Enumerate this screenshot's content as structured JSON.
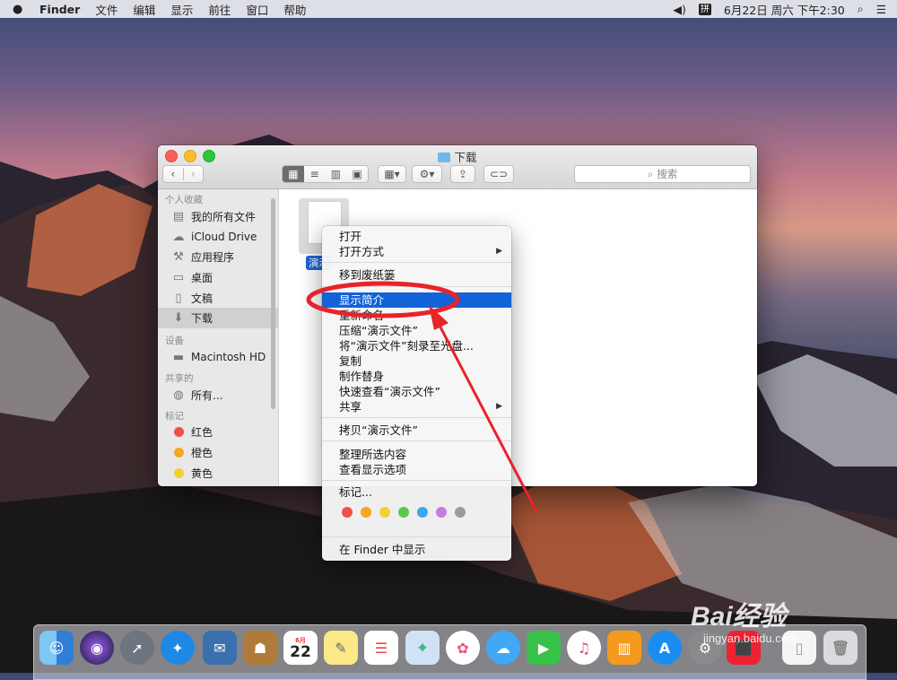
{
  "menubar": {
    "apple": "",
    "app": "Finder",
    "items": [
      "文件",
      "编辑",
      "显示",
      "前往",
      "窗口",
      "帮助"
    ],
    "ime": "拼",
    "datetime": "6月22日 周六 下午2:30"
  },
  "window": {
    "title": "下载",
    "search_placeholder": "搜索"
  },
  "sidebar": {
    "favorites_header": "个人收藏",
    "favorites": [
      "我的所有文件",
      "iCloud Drive",
      "应用程序",
      "桌面",
      "文稿",
      "下载"
    ],
    "devices_header": "设备",
    "devices": [
      "Macintosh HD"
    ],
    "shared_header": "共享的",
    "shared": [
      "所有..."
    ],
    "tags_header": "标记",
    "tags": [
      {
        "label": "红色",
        "color": "#f0504a"
      },
      {
        "label": "橙色",
        "color": "#f5a623"
      },
      {
        "label": "黄色",
        "color": "#f3d031"
      }
    ]
  },
  "content": {
    "file_label": "演示"
  },
  "context_menu": {
    "items": [
      "打开",
      "打开方式",
      "移到废纸篓",
      "显示简介",
      "重新命名",
      "压缩“演示文件”",
      "将“演示文件”刻录至光盘...",
      "复制",
      "制作替身",
      "快速查看“演示文件”",
      "共享",
      "拷贝“演示文件”",
      "整理所选内容",
      "查看显示选项",
      "标记...",
      "在 Finder 中显示"
    ],
    "highlighted": "显示简介",
    "tag_colors": [
      "#f0504a",
      "#f5a623",
      "#f3d031",
      "#5ac948",
      "#3aa7ee",
      "#c57cde",
      "#9b9b9b"
    ]
  },
  "watermark": {
    "text": "Bai经验",
    "url": "jingyan.baidu.com"
  },
  "dock": {
    "calendar_month": "6月",
    "calendar_day": "22"
  }
}
